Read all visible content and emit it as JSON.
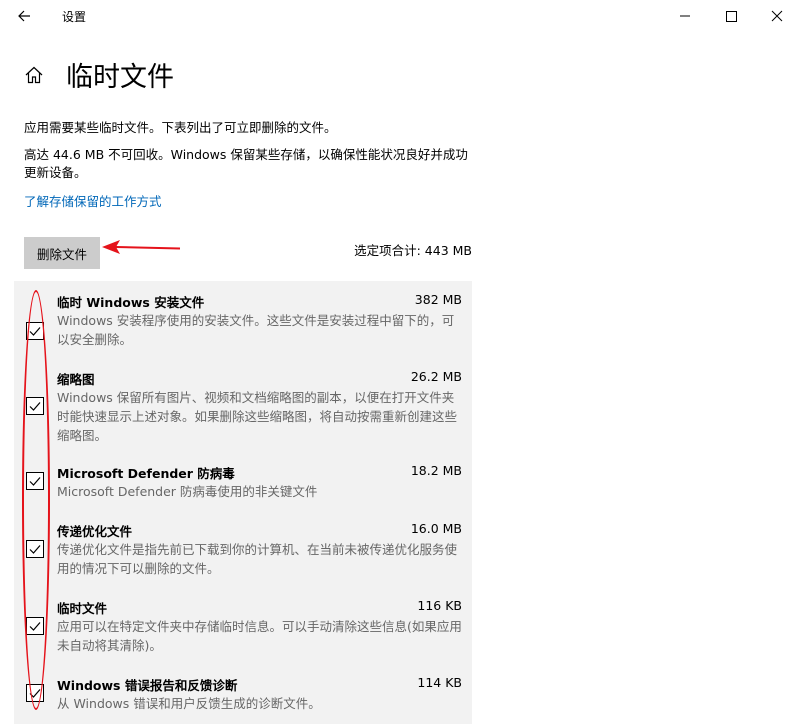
{
  "window": {
    "title": "设置"
  },
  "page": {
    "title": "临时文件",
    "description1": "应用需要某些临时文件。下表列出了可立即删除的文件。",
    "description2": "高达 44.6 MB 不可回收。Windows 保留某些存储，以确保性能状况良好并成功更新设备。",
    "link": "了解存储保留的工作方式",
    "delete_button": "删除文件",
    "selected_total": "选定项合计: 443 MB"
  },
  "items": [
    {
      "name": "临时 Windows 安装文件",
      "size": "382 MB",
      "desc": "Windows 安装程序使用的安装文件。这些文件是安装过程中留下的，可以安全删除。",
      "checked": true
    },
    {
      "name": "缩略图",
      "size": "26.2 MB",
      "desc": "Windows 保留所有图片、视频和文档缩略图的副本，以便在打开文件夹时能快速显示上述对象。如果删除这些缩略图，将自动按需重新创建这些缩略图。",
      "checked": true
    },
    {
      "name": "Microsoft Defender 防病毒",
      "size": "18.2 MB",
      "desc": "Microsoft Defender 防病毒使用的非关键文件",
      "checked": true
    },
    {
      "name": "传递优化文件",
      "size": "16.0 MB",
      "desc": "传递优化文件是指先前已下载到你的计算机、在当前未被传递优化服务使用的情况下可以删除的文件。",
      "checked": true
    },
    {
      "name": "临时文件",
      "size": "116 KB",
      "desc": "应用可以在特定文件夹中存储临时信息。可以手动清除这些信息(如果应用未自动将其清除)。",
      "checked": true
    },
    {
      "name": "Windows 错误报告和反馈诊断",
      "size": "114 KB",
      "desc": "从 Windows 错误和用户反馈生成的诊断文件。",
      "checked": true
    }
  ],
  "annotation_color": "#e5131b",
  "link_color": "#0067b8"
}
